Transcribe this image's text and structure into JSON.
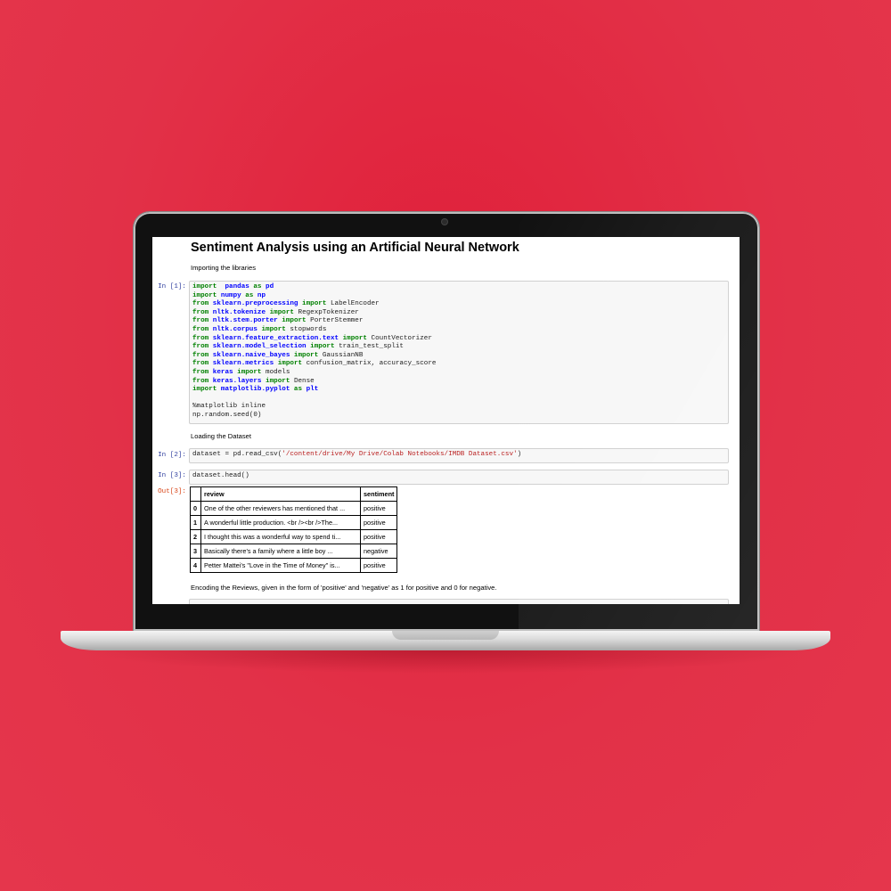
{
  "notebook": {
    "title": "Sentiment Analysis using an Artificial Neural Network",
    "md1": "Importing the libraries",
    "prompt1": "In [1]:",
    "cell1": [
      [
        [
          "kw",
          "import"
        ],
        [
          "",
          "  "
        ],
        [
          "mod",
          "pandas"
        ],
        [
          "",
          ""
        ],
        [
          "kw",
          " as"
        ],
        [
          "mod",
          " pd"
        ]
      ],
      [
        [
          "kw",
          "import"
        ],
        [
          "mod",
          " numpy"
        ],
        [
          "kw",
          " as"
        ],
        [
          "mod",
          " np"
        ]
      ],
      [
        [
          "kw",
          "from"
        ],
        [
          "mod",
          " sklearn.preprocessing"
        ],
        [
          "kw",
          " import"
        ],
        [
          "",
          " LabelEncoder"
        ]
      ],
      [
        [
          "kw",
          "from"
        ],
        [
          "mod",
          " nltk.tokenize"
        ],
        [
          "kw",
          " import"
        ],
        [
          "",
          " RegexpTokenizer"
        ]
      ],
      [
        [
          "kw",
          "from"
        ],
        [
          "mod",
          " nltk.stem.porter"
        ],
        [
          "kw",
          " import"
        ],
        [
          "",
          " PorterStemmer"
        ]
      ],
      [
        [
          "kw",
          "from"
        ],
        [
          "mod",
          " nltk.corpus"
        ],
        [
          "kw",
          " import"
        ],
        [
          "",
          " stopwords"
        ]
      ],
      [
        [
          "kw",
          "from"
        ],
        [
          "mod",
          " sklearn.feature_extraction.text"
        ],
        [
          "kw",
          " import"
        ],
        [
          "",
          " CountVectorizer"
        ]
      ],
      [
        [
          "kw",
          "from"
        ],
        [
          "mod",
          " sklearn.model_selection"
        ],
        [
          "kw",
          " import"
        ],
        [
          "",
          " train_test_split"
        ]
      ],
      [
        [
          "kw",
          "from"
        ],
        [
          "mod",
          " sklearn.naive_bayes"
        ],
        [
          "kw",
          " import"
        ],
        [
          "",
          " GaussianNB"
        ]
      ],
      [
        [
          "kw",
          "from"
        ],
        [
          "mod",
          " sklearn.metrics"
        ],
        [
          "kw",
          " import"
        ],
        [
          "",
          " confusion_matrix, accuracy_score"
        ]
      ],
      [
        [
          "kw",
          "from"
        ],
        [
          "mod",
          " keras"
        ],
        [
          "kw",
          " import"
        ],
        [
          "",
          " models"
        ]
      ],
      [
        [
          "kw",
          "from"
        ],
        [
          "mod",
          " keras.layers"
        ],
        [
          "kw",
          " import"
        ],
        [
          "",
          " Dense"
        ]
      ],
      [
        [
          "kw",
          "import"
        ],
        [
          "mod",
          " matplotlib.pyplot"
        ],
        [
          "kw",
          " as"
        ],
        [
          "mod",
          " plt"
        ]
      ],
      [
        [
          "",
          ""
        ]
      ],
      [
        [
          "",
          "%matplotlib inline"
        ]
      ],
      [
        [
          "",
          "np.random.seed(0)"
        ]
      ]
    ],
    "md2": "Loading the Dataset",
    "prompt2": "In [2]:",
    "cell2": [
      [
        [
          "",
          "dataset = pd.read_csv("
        ],
        [
          "str",
          "'/content/drive/My Drive/Colab Notebooks/IMDB Dataset.csv'"
        ],
        [
          "",
          ")"
        ]
      ]
    ],
    "prompt3": "In [3]:",
    "cell3": [
      [
        [
          "",
          "dataset.head()"
        ]
      ]
    ],
    "out3": "Out[3]:",
    "table": {
      "columns": [
        "",
        "review",
        "sentiment"
      ],
      "rows": [
        [
          "0",
          "One of the other reviewers has mentioned that ...",
          "positive"
        ],
        [
          "1",
          "A wonderful little production. <br /><br />The...",
          "positive"
        ],
        [
          "2",
          "I thought this was a wonderful way to spend ti...",
          "positive"
        ],
        [
          "3",
          "Basically there's a family where a little boy ...",
          "negative"
        ],
        [
          "4",
          "Petter Mattei's \"Love in the Time of Money\" is...",
          "positive"
        ]
      ]
    },
    "md3": "Encoding the Reviews, given in the form of 'positive' and 'negative' as 1 for positive and 0 for negative."
  }
}
